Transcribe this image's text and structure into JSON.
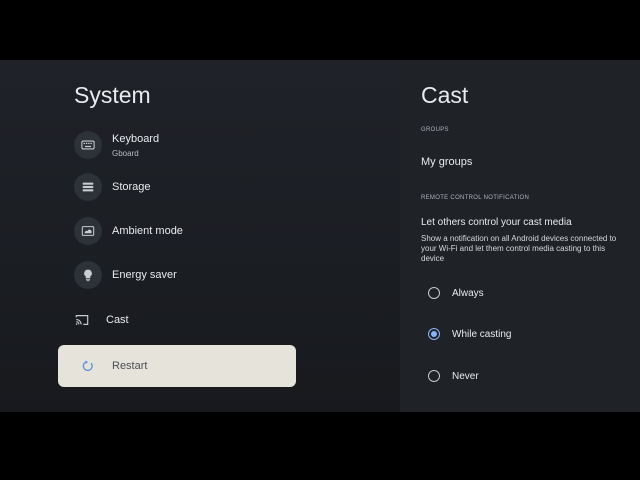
{
  "system": {
    "title": "System",
    "items": [
      {
        "label": "Keyboard",
        "sublabel": "Gboard",
        "icon": "keyboard-icon"
      },
      {
        "label": "Storage",
        "icon": "storage-icon"
      },
      {
        "label": "Ambient mode",
        "icon": "ambient-mode-icon"
      },
      {
        "label": "Energy saver",
        "icon": "energy-saver-icon"
      },
      {
        "label": "Cast",
        "icon": "cast-icon"
      },
      {
        "label": "Restart",
        "icon": "restart-icon"
      }
    ],
    "selected_index": 5
  },
  "cast": {
    "title": "Cast",
    "groups_section": "GROUPS",
    "my_groups": "My groups",
    "remote_section": "REMOTE CONTROL NOTIFICATION",
    "remote_title": "Let others control your cast media",
    "remote_description": "Show a notification on all Android devices connected to your Wi-Fi and let them control media casting to this device",
    "options": [
      {
        "label": "Always",
        "selected": false
      },
      {
        "label": "While casting",
        "selected": true
      },
      {
        "label": "Never",
        "selected": false
      }
    ]
  },
  "colors": {
    "accent": "#8ab4f8",
    "selected_row": "#e6e3da",
    "background": "#1f2228"
  }
}
